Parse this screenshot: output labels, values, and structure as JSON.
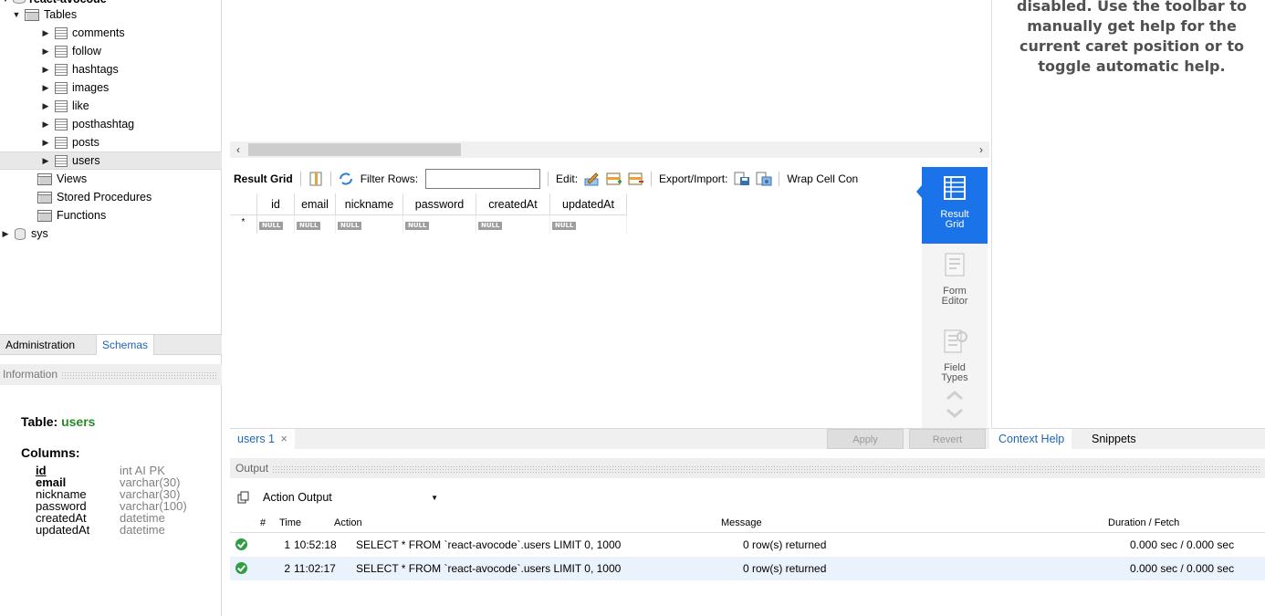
{
  "tree": {
    "top_label": "react-avocode",
    "tables_label": "Tables",
    "tables": [
      "comments",
      "follow",
      "hashtags",
      "images",
      "like",
      "posthashtag",
      "posts",
      "users"
    ],
    "views_label": "Views",
    "procedures_label": "Stored Procedures",
    "functions_label": "Functions",
    "sys_label": "sys"
  },
  "sidebar_tabs": {
    "administration": "Administration",
    "schemas": "Schemas"
  },
  "info": {
    "header": "Information",
    "table_prefix": "Table: ",
    "table_name": "users",
    "columns_title": "Columns:",
    "columns": [
      {
        "name": "id",
        "type": "int AI PK"
      },
      {
        "name": "email",
        "type": "varchar(30)"
      },
      {
        "name": "nickname",
        "type": "varchar(30)"
      },
      {
        "name": "password",
        "type": "varchar(100)"
      },
      {
        "name": "createdAt",
        "type": "datetime"
      },
      {
        "name": "updatedAt",
        "type": "datetime"
      }
    ]
  },
  "result_toolbar": {
    "result_grid": "Result Grid",
    "filter_rows": "Filter Rows:",
    "filter_value": "",
    "edit": "Edit:",
    "export_import": "Export/Import:",
    "wrap": "Wrap Cell Con"
  },
  "grid": {
    "columns": [
      "id",
      "email",
      "nickname",
      "password",
      "createdAt",
      "updatedAt"
    ],
    "null_text": "NULL",
    "new_row_marker": "*"
  },
  "result_panel": {
    "result_grid": [
      "Result",
      "Grid"
    ],
    "form_editor": [
      "Form",
      "Editor"
    ],
    "field_types": [
      "Field",
      "Types"
    ]
  },
  "query_tab": {
    "label": "users 1",
    "close": "×"
  },
  "buttons": {
    "apply": "Apply",
    "revert": "Revert"
  },
  "help": {
    "text": "disabled. Use the toolbar to manually get help for the current caret position or to toggle automatic help.",
    "tabs": {
      "context_help": "Context Help",
      "snippets": "Snippets"
    }
  },
  "output": {
    "header": "Output",
    "selector": "Action Output",
    "columns": {
      "num": "#",
      "time": "Time",
      "action": "Action",
      "message": "Message",
      "duration": "Duration / Fetch"
    },
    "rows": [
      {
        "num": "1",
        "time": "10:52:18",
        "action": "SELECT * FROM `react-avocode`.users LIMIT 0, 1000",
        "message": "0 row(s) returned",
        "duration": "0.000 sec / 0.000 sec"
      },
      {
        "num": "2",
        "time": "11:02:17",
        "action": "SELECT * FROM `react-avocode`.users LIMIT 0, 1000",
        "message": "0 row(s) returned",
        "duration": "0.000 sec / 0.000 sec"
      }
    ]
  },
  "colors": {
    "accent": "#1a73e8",
    "tab_blue": "#1f66b7",
    "table_name_green": "#2a8a2a",
    "ok_green": "#2f9e44"
  }
}
